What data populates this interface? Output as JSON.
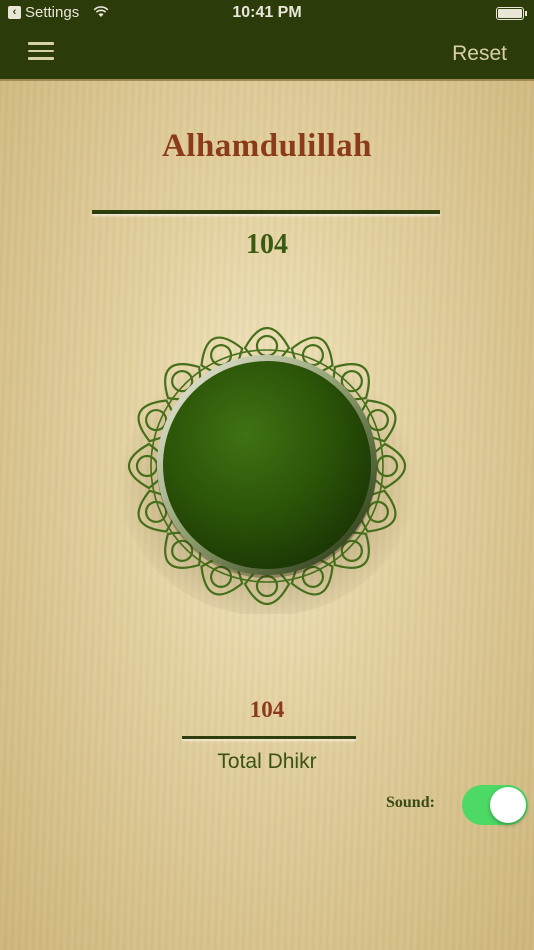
{
  "status_bar": {
    "back_label": "Settings",
    "time": "10:41 PM"
  },
  "nav": {
    "reset_label": "Reset"
  },
  "dhikr": {
    "name": "Alhamdulillah",
    "count": "104"
  },
  "total": {
    "count": "104",
    "label": "Total Dhikr"
  },
  "sound": {
    "label": "Sound:",
    "enabled": true
  },
  "colors": {
    "topbar": "#2b3b0a",
    "title": "#8b3a1a",
    "count": "#3a5a12",
    "toggle_on": "#4cd964",
    "button_green": "#2f5a0a"
  }
}
